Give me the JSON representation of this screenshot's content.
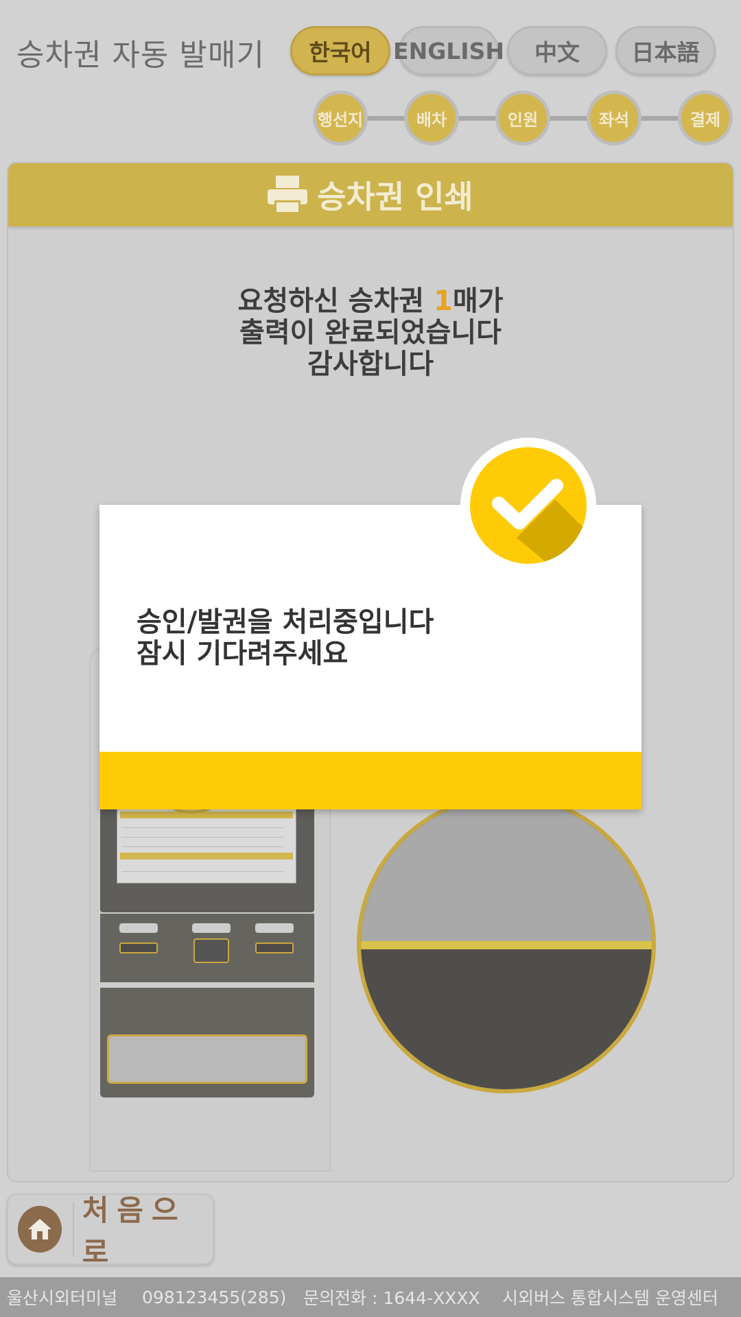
{
  "header": {
    "title": "승차권 자동 발매기",
    "languages": [
      {
        "label": "한국어",
        "active": true
      },
      {
        "label": "ENGLISH",
        "active": false
      },
      {
        "label": "中文",
        "active": false
      },
      {
        "label": "日本語",
        "active": false
      }
    ]
  },
  "steps": [
    "행선지",
    "배차",
    "인원",
    "좌석",
    "결제"
  ],
  "panel": {
    "title": "승차권 인쇄",
    "icon": "printer-icon",
    "message": {
      "prefix": "요청하신 승차권 ",
      "count": "1",
      "suffix": "매가",
      "line2": "출력이 완료되었습니다",
      "line3": "감사합니다"
    }
  },
  "modal": {
    "icon": "check-icon",
    "line1": "승인/발권을 처리중입니다",
    "line2": "잠시 기다려주세요"
  },
  "home_button": {
    "label": "처음으로",
    "icon": "home-icon"
  },
  "footer": {
    "terminal": "울산시외터미널",
    "code": "098123455(285)",
    "phone": "문의전화 : 1644-XXXX",
    "operator": "시외버스 통합시스템 운영센터"
  },
  "colors": {
    "accent": "#ffcb06",
    "panel_header": "#ccb34c",
    "count_highlight": "#e8a21e",
    "home": "#8c6a4c"
  }
}
